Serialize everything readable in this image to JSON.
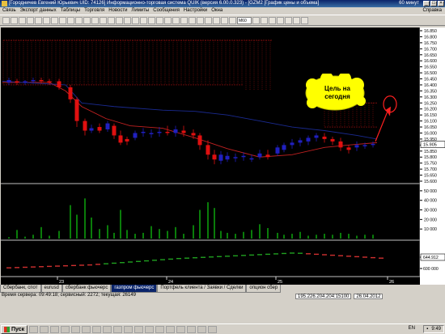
{
  "window": {
    "title": "[Городничев Евгений Юрьевич UID: 74126] Информационно-торговая система QUIK (версия 6.00.0.323) - [GZM2 [График цены и объема]",
    "timeframe": "60 минут",
    "controls": [
      "_",
      "□",
      "×"
    ]
  },
  "menu": [
    "Связь",
    "Экспорт данных",
    "Таблицы",
    "Торговля",
    "Новости",
    "Лимиты",
    "Сообщения",
    "Настройки",
    "Окна"
  ],
  "menu_help": "Справка",
  "toolbar": {
    "interval_select": "M60"
  },
  "chart": {
    "price_ticks": [
      "16.850",
      "16.800",
      "16.750",
      "16.700",
      "16.650",
      "16.600",
      "16.550",
      "16.500",
      "16.450",
      "16.400",
      "16.350",
      "16.300",
      "16.250",
      "16.200",
      "16.150",
      "16.100",
      "16.050",
      "16.000",
      "15.950",
      "15.900",
      "15.850",
      "15.800",
      "15.750",
      "15.700",
      "15.650",
      "15.600"
    ],
    "current_price": "15.905",
    "volume_ticks": [
      "50 000",
      "40 000",
      "30 000",
      "20 000",
      "10 000"
    ],
    "osc_ticks": [
      "644.912",
      "600 000"
    ],
    "date_ticks": [
      "23",
      "24",
      "25",
      "26"
    ],
    "callout_text": "Цель на сегодня",
    "colors": {
      "up": "#2020c0",
      "down": "#e01010",
      "cloud": "#a01010",
      "base": "#c02020",
      "conv": "#1a2a90",
      "volume": "#10c010",
      "target": "#ff2020"
    }
  },
  "tabs": [
    {
      "label": "Сбербанк, спот",
      "active": false
    },
    {
      "label": "eurusd",
      "active": false
    },
    {
      "label": "сбербанк фьючерс",
      "active": false
    },
    {
      "label": "газпром фьючерс",
      "active": true
    },
    {
      "label": "Портфель клиента / Заявки / Сделки",
      "active": false
    },
    {
      "label": "опцион сбер",
      "active": false
    }
  ],
  "status": {
    "server_time": "Время сервера: 09:49:18; сервисный: 2272; текущая: 26149",
    "ip": "195.226.204.204:15100",
    "date": "26.04.2012"
  },
  "taskbar": {
    "start": "Пуск",
    "lang": "EN",
    "clock": "9:49"
  }
}
